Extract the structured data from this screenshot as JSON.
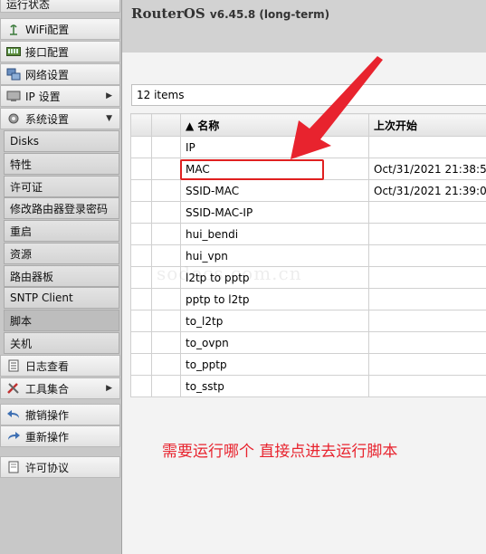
{
  "header": {
    "product": "RouterOS",
    "version": "v6.45.8 (long-term)"
  },
  "sidebar": {
    "top_item": "运行状态",
    "items": [
      {
        "label": "WiFi配置",
        "icon": "antenna-icon"
      },
      {
        "label": "接口配置",
        "icon": "interface-icon"
      },
      {
        "label": "网络设置",
        "icon": "network-icon"
      },
      {
        "label": "IP 设置",
        "icon": "ip-icon",
        "arrow": "▶"
      },
      {
        "label": "系统设置",
        "icon": "gear-icon",
        "arrow": "▼"
      }
    ],
    "system_sub": [
      "Disks",
      "特性",
      "许可证",
      "修改路由器登录密码",
      "重启",
      "资源",
      "路由器板",
      "SNTP Client",
      "脚本",
      "关机"
    ],
    "bottom_items": [
      {
        "label": "日志查看",
        "icon": "log-icon"
      },
      {
        "label": "工具集合",
        "icon": "tools-icon",
        "arrow": "▶"
      },
      {
        "label": "撤销操作",
        "icon": "undo-icon"
      },
      {
        "label": "重新操作",
        "icon": "redo-icon"
      },
      {
        "label": "许可协议",
        "icon": "license-icon"
      }
    ]
  },
  "list": {
    "count_label": "12 items",
    "columns": {
      "name": "▲ 名称",
      "last_started": "上次开始"
    },
    "rows": [
      {
        "name": "IP",
        "last_started": ""
      },
      {
        "name": "MAC",
        "last_started": "Oct/31/2021 21:38:5"
      },
      {
        "name": "SSID-MAC",
        "last_started": "Oct/31/2021 21:39:0"
      },
      {
        "name": "SSID-MAC-IP",
        "last_started": ""
      },
      {
        "name": "hui_bendi",
        "last_started": ""
      },
      {
        "name": "hui_vpn",
        "last_started": ""
      },
      {
        "name": "l2tp to pptp",
        "last_started": ""
      },
      {
        "name": "pptp to l2tp",
        "last_started": ""
      },
      {
        "name": "to_l2tp",
        "last_started": ""
      },
      {
        "name": "to_ovpn",
        "last_started": ""
      },
      {
        "name": "to_pptp",
        "last_started": ""
      },
      {
        "name": "to_sstp",
        "last_started": ""
      }
    ]
  },
  "annotation": "需要运行哪个 直接点进去运行脚本",
  "watermark": "sodocs.com.cn",
  "colors": {
    "accent_red": "#e02020"
  }
}
